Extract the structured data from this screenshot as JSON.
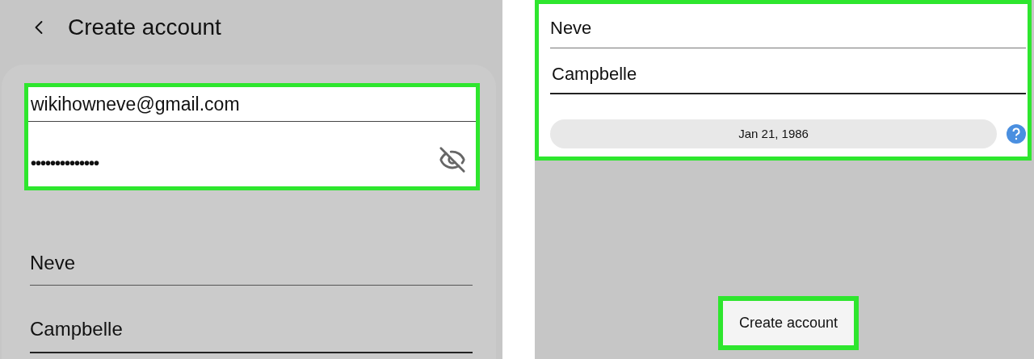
{
  "left_screen": {
    "title": "Create account",
    "credentials": {
      "highlighted": true,
      "email": "wikihowneve@gmail.com",
      "password": "••••••••••••••",
      "password_visible": false
    },
    "first_name": "Neve",
    "last_name": "Campbelle"
  },
  "right_screen": {
    "fields": {
      "highlighted": true,
      "first_name": "Neve",
      "last_name": "Campbelle",
      "birth_date": "Jan 21, 1986"
    },
    "create_button": {
      "label": "Create account",
      "highlighted": true
    }
  }
}
